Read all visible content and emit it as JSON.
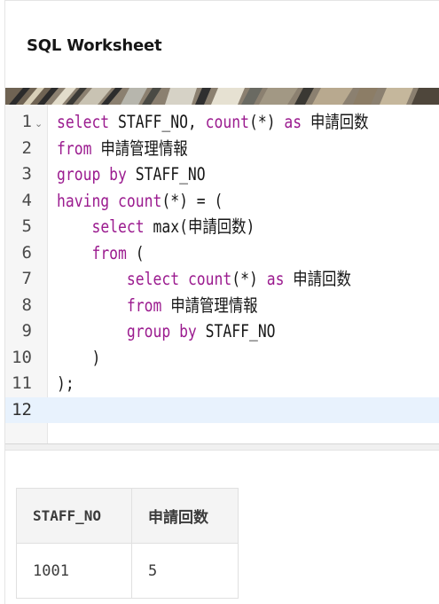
{
  "worksheet": {
    "title": "SQL Worksheet"
  },
  "editor": {
    "lines": [
      {
        "no": "1",
        "tokens": [
          {
            "t": "select",
            "kw": true
          },
          {
            "t": " STAFF_NO, ",
            "kw": false
          },
          {
            "t": "count",
            "kw": true
          },
          {
            "t": "(*) ",
            "kw": false
          },
          {
            "t": "as",
            "kw": true
          },
          {
            "t": " 申請回数",
            "kw": false
          }
        ]
      },
      {
        "no": "2",
        "tokens": [
          {
            "t": "from",
            "kw": true
          },
          {
            "t": " 申請管理情報",
            "kw": false
          }
        ]
      },
      {
        "no": "3",
        "tokens": [
          {
            "t": "group by",
            "kw": true
          },
          {
            "t": " STAFF_NO",
            "kw": false
          }
        ]
      },
      {
        "no": "4",
        "tokens": [
          {
            "t": "having",
            "kw": true
          },
          {
            "t": " ",
            "kw": false
          },
          {
            "t": "count",
            "kw": true
          },
          {
            "t": "(*) = (",
            "kw": false
          }
        ]
      },
      {
        "no": "5",
        "tokens": [
          {
            "t": "    ",
            "kw": false
          },
          {
            "t": "select",
            "kw": true
          },
          {
            "t": " max(申請回数)",
            "kw": false
          }
        ]
      },
      {
        "no": "6",
        "tokens": [
          {
            "t": "    ",
            "kw": false
          },
          {
            "t": "from",
            "kw": true
          },
          {
            "t": " (",
            "kw": false
          }
        ]
      },
      {
        "no": "7",
        "tokens": [
          {
            "t": "        ",
            "kw": false
          },
          {
            "t": "select",
            "kw": true
          },
          {
            "t": " ",
            "kw": false
          },
          {
            "t": "count",
            "kw": true
          },
          {
            "t": "(*) ",
            "kw": false
          },
          {
            "t": "as",
            "kw": true
          },
          {
            "t": " 申請回数",
            "kw": false
          }
        ]
      },
      {
        "no": "8",
        "tokens": [
          {
            "t": "        ",
            "kw": false
          },
          {
            "t": "from",
            "kw": true
          },
          {
            "t": " 申請管理情報",
            "kw": false
          }
        ]
      },
      {
        "no": "9",
        "tokens": [
          {
            "t": "        ",
            "kw": false
          },
          {
            "t": "group by",
            "kw": true
          },
          {
            "t": " STAFF_NO",
            "kw": false
          }
        ]
      },
      {
        "no": "10",
        "tokens": [
          {
            "t": "    )",
            "kw": false
          }
        ]
      },
      {
        "no": "11",
        "tokens": [
          {
            "t": ");",
            "kw": false
          }
        ]
      },
      {
        "no": "12",
        "tokens": []
      }
    ]
  },
  "results": {
    "headers": [
      "STAFF_NO",
      "申請回数"
    ],
    "rows": [
      [
        "1001",
        "5"
      ]
    ]
  },
  "colors": {
    "keyword": "#9b1b8f",
    "active_line": "#e8f2fd",
    "gutter": "#f6f6f6"
  },
  "icons": {
    "fold": "chevron-down-icon"
  }
}
